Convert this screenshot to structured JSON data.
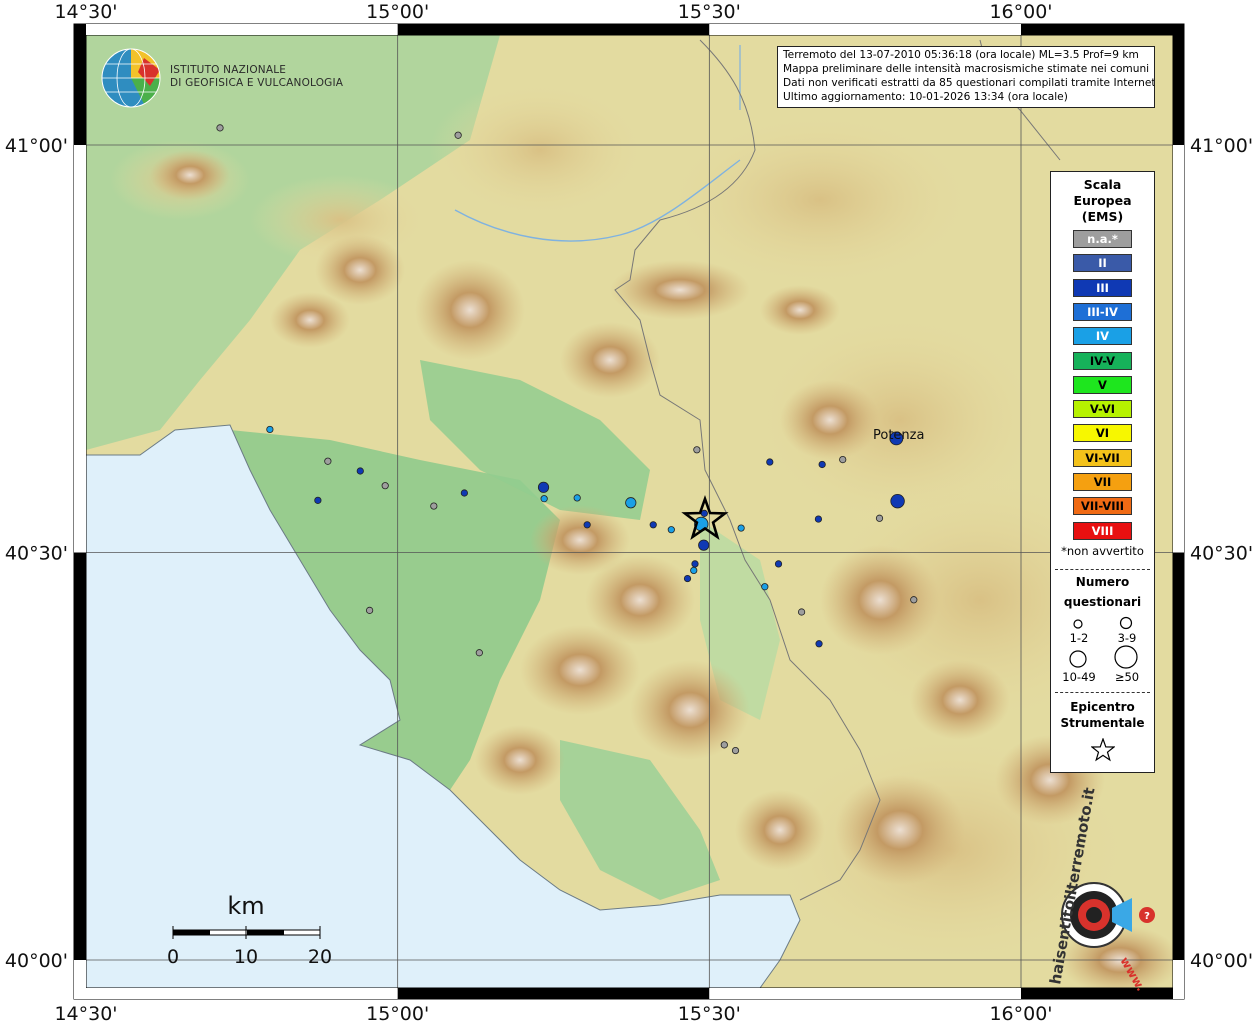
{
  "info": {
    "line1": "Terremoto del 13-07-2010 05:36:18 (ora locale) ML=3.5 Prof=9 km",
    "line2": "Mappa preliminare delle intensità macrosismiche stimate nei comuni",
    "line3": "Dati non verificati estratti da 85 questionari compilati tramite Internet.",
    "line4": "Ultimo aggiornamento: 10-01-2026 13:34 (ora locale)"
  },
  "logo": {
    "line1": "ISTITUTO NAZIONALE",
    "line2": "DI GEOFISICA E VULCANOLOGIA"
  },
  "legend": {
    "title_line1": "Scala",
    "title_line2": "Europea",
    "title_line3": "(EMS)",
    "classes": [
      {
        "label": "n.a.*",
        "color": "#9e9e9e",
        "text_color": "#ffffff"
      },
      {
        "label": "II",
        "color": "#3a5aa8",
        "text_color": "#ffffff"
      },
      {
        "label": "III",
        "color": "#0f39b4",
        "text_color": "#ffffff"
      },
      {
        "label": "III-IV",
        "color": "#1e6fd6",
        "text_color": "#ffffff"
      },
      {
        "label": "IV",
        "color": "#1aa0e6",
        "text_color": "#ffffff"
      },
      {
        "label": "IV-V",
        "color": "#16b25a",
        "text_color": "#000000"
      },
      {
        "label": "V",
        "color": "#1ee61e",
        "text_color": "#000000"
      },
      {
        "label": "V-VI",
        "color": "#b6f200",
        "text_color": "#000000"
      },
      {
        "label": "VI",
        "color": "#f7f700",
        "text_color": "#000000"
      },
      {
        "label": "VI-VII",
        "color": "#f4c21a",
        "text_color": "#000000"
      },
      {
        "label": "VII",
        "color": "#f5a010",
        "text_color": "#000000"
      },
      {
        "label": "VII-VIII",
        "color": "#f06a14",
        "text_color": "#000000"
      },
      {
        "label": "VIII",
        "color": "#e81010",
        "text_color": "#ffffff"
      }
    ],
    "not_felt_note": "*non avvertito",
    "count_title_line1": "Numero",
    "count_title_line2": "questionari",
    "count_sizes": [
      "1-2",
      "3-9",
      "10-49",
      "≥50"
    ],
    "epicenter_line1": "Epicentro",
    "epicenter_line2": "Strumentale"
  },
  "axes": {
    "lon_labels": [
      "14°30'",
      "15°00'",
      "15°30'",
      "16°00'"
    ],
    "lat_labels": [
      "41°00'",
      "40°30'",
      "40°00'"
    ]
  },
  "city": {
    "name": "Potenza"
  },
  "scale_bar": {
    "unit": "km",
    "ticks": [
      "0",
      "10",
      "20"
    ]
  },
  "site_logo": {
    "text": "haisentitoilterremoto.it",
    "url": "www."
  },
  "colors": {
    "sea": "#dff0fa",
    "lowland": "#8ec98e",
    "hill": "#e7e0a6",
    "mountain": "#c9a26a",
    "peak": "#e9ddd0",
    "na": "#9e9e9e",
    "iii": "#0f39b4",
    "iv": "#1aa0e6"
  },
  "points": [
    {
      "lon": 14.715,
      "lat": 41.021,
      "int": "n.a.",
      "size": 1
    },
    {
      "lon": 15.097,
      "lat": 41.012,
      "int": "n.a.",
      "size": 1
    },
    {
      "lon": 14.795,
      "lat": 40.651,
      "int": "IV",
      "size": 1
    },
    {
      "lon": 14.888,
      "lat": 40.612,
      "int": "n.a.",
      "size": 1
    },
    {
      "lon": 14.94,
      "lat": 40.6,
      "int": "III",
      "size": 1
    },
    {
      "lon": 14.98,
      "lat": 40.582,
      "int": "n.a.",
      "size": 1
    },
    {
      "lon": 14.872,
      "lat": 40.564,
      "int": "III",
      "size": 1
    },
    {
      "lon": 15.058,
      "lat": 40.557,
      "int": "n.a.",
      "size": 1
    },
    {
      "lon": 15.107,
      "lat": 40.573,
      "int": "III",
      "size": 1
    },
    {
      "lon": 15.234,
      "lat": 40.58,
      "int": "III",
      "size": 2
    },
    {
      "lon": 15.235,
      "lat": 40.566,
      "int": "IV",
      "size": 1
    },
    {
      "lon": 15.288,
      "lat": 40.567,
      "int": "IV",
      "size": 1
    },
    {
      "lon": 15.374,
      "lat": 40.561,
      "int": "IV",
      "size": 2
    },
    {
      "lon": 15.48,
      "lat": 40.626,
      "int": "n.a.",
      "size": 1
    },
    {
      "lon": 15.597,
      "lat": 40.611,
      "int": "III",
      "size": 1
    },
    {
      "lon": 15.681,
      "lat": 40.608,
      "int": "III",
      "size": 1
    },
    {
      "lon": 15.714,
      "lat": 40.614,
      "int": "n.a.",
      "size": 1
    },
    {
      "lon": 15.802,
      "lat": 40.563,
      "int": "III",
      "size": 3
    },
    {
      "lon": 15.675,
      "lat": 40.541,
      "int": "III",
      "size": 1
    },
    {
      "lon": 15.773,
      "lat": 40.542,
      "int": "n.a.",
      "size": 1
    },
    {
      "lon": 15.304,
      "lat": 40.534,
      "int": "III",
      "size": 1
    },
    {
      "lon": 15.41,
      "lat": 40.534,
      "int": "III",
      "size": 1
    },
    {
      "lon": 15.439,
      "lat": 40.528,
      "int": "IV",
      "size": 1
    },
    {
      "lon": 15.492,
      "lat": 40.548,
      "int": "III",
      "size": 1
    },
    {
      "lon": 15.487,
      "lat": 40.535,
      "int": "IV",
      "size": 3
    },
    {
      "lon": 15.551,
      "lat": 40.53,
      "int": "IV",
      "size": 1
    },
    {
      "lon": 15.491,
      "lat": 40.509,
      "int": "III",
      "size": 2
    },
    {
      "lon": 15.477,
      "lat": 40.486,
      "int": "III",
      "size": 1
    },
    {
      "lon": 15.475,
      "lat": 40.478,
      "int": "IV",
      "size": 1
    },
    {
      "lon": 15.465,
      "lat": 40.468,
      "int": "III",
      "size": 1
    },
    {
      "lon": 15.611,
      "lat": 40.486,
      "int": "III",
      "size": 1
    },
    {
      "lon": 15.589,
      "lat": 40.458,
      "int": "IV",
      "size": 1
    },
    {
      "lon": 15.828,
      "lat": 40.442,
      "int": "n.a.",
      "size": 1
    },
    {
      "lon": 15.648,
      "lat": 40.427,
      "int": "n.a.",
      "size": 1
    },
    {
      "lon": 15.676,
      "lat": 40.388,
      "int": "III",
      "size": 1
    },
    {
      "lon": 14.955,
      "lat": 40.429,
      "int": "n.a.",
      "size": 1
    },
    {
      "lon": 15.131,
      "lat": 40.377,
      "int": "n.a.",
      "size": 1
    },
    {
      "lon": 15.524,
      "lat": 40.264,
      "int": "n.a.",
      "size": 1
    },
    {
      "lon": 15.542,
      "lat": 40.257,
      "int": "n.a.",
      "size": 1
    }
  ],
  "epicenter": {
    "lon": 15.493,
    "lat": 40.54
  },
  "city_point": {
    "lon": 15.8,
    "lat": 40.64
  }
}
